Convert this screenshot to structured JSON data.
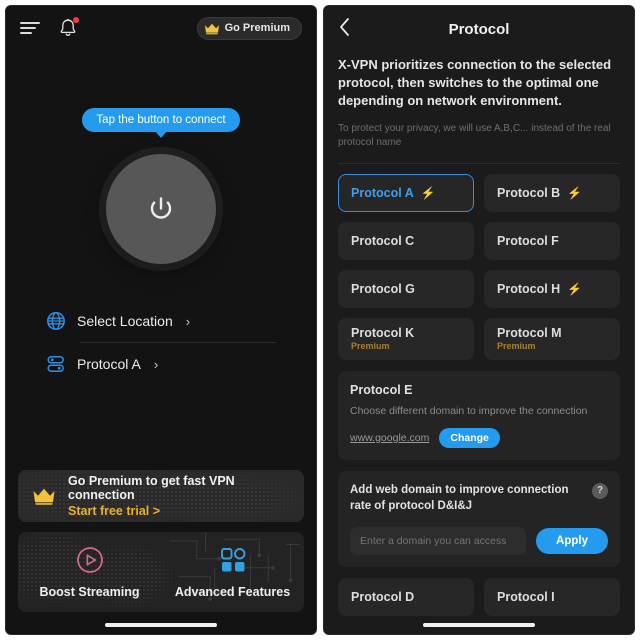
{
  "home": {
    "topbar": {
      "menu_icon": "hamburger-menu-icon",
      "notifications_icon": "bell-icon",
      "premium_button_label": "Go Premium",
      "premium_icon": "crown-icon"
    },
    "connect": {
      "tooltip": "Tap the button to connect",
      "power_icon": "power-icon"
    },
    "rows": [
      {
        "label": "Select Location",
        "chevron": "›",
        "icon": "globe-icon"
      },
      {
        "label": "Protocol A",
        "chevron": "›",
        "icon": "protocol-icon"
      }
    ],
    "banner": {
      "title": "Go Premium to get fast VPN connection",
      "cta": "Start free trial >",
      "icon": "crown-icon"
    },
    "features": [
      {
        "label": "Boost Streaming",
        "icon": "play-circle-icon",
        "color": "#d9658f"
      },
      {
        "label": "Advanced Features",
        "icon": "grid-squares-icon",
        "color": "#34a0e0"
      }
    ]
  },
  "protocol": {
    "header": {
      "back_icon": "chevron-left-icon",
      "title": "Protocol"
    },
    "description": "X-VPN prioritizes connection to the selected protocol, then switches to the optimal one depending on network environment.",
    "privacy_note": "To protect your privacy, we will use A,B,C... instead of the real protocol name",
    "items_top": [
      {
        "name": "Protocol A",
        "bolt": "⚡",
        "selected": true,
        "premium": ""
      },
      {
        "name": "Protocol B",
        "bolt": "⚡",
        "selected": false,
        "premium": ""
      },
      {
        "name": "Protocol C",
        "bolt": "",
        "selected": false,
        "premium": ""
      },
      {
        "name": "Protocol F",
        "bolt": "",
        "selected": false,
        "premium": ""
      },
      {
        "name": "Protocol G",
        "bolt": "",
        "selected": false,
        "premium": ""
      },
      {
        "name": "Protocol H",
        "bolt": "⚡",
        "selected": false,
        "premium": ""
      },
      {
        "name": "Protocol K",
        "bolt": "",
        "selected": false,
        "premium": "Premium"
      },
      {
        "name": "Protocol M",
        "bolt": "",
        "selected": false,
        "premium": "Premium"
      }
    ],
    "protocol_e_card": {
      "title": "Protocol E",
      "subtitle": "Choose different domain to improve the connection",
      "domain": "www.google.com",
      "change_label": "Change"
    },
    "add_domain_card": {
      "title": "Add web domain to improve connection rate of protocol D&I&J",
      "help_icon": "question-mark-icon",
      "input_placeholder": "Enter a domain you can access",
      "input_value": "",
      "apply_label": "Apply"
    },
    "items_bottom": [
      {
        "name": "Protocol D",
        "bolt": "",
        "selected": false,
        "premium": ""
      },
      {
        "name": "Protocol I",
        "bolt": "",
        "selected": false,
        "premium": ""
      }
    ]
  },
  "colors": {
    "accent_blue": "#259bf0",
    "gold": "#e9b225",
    "pink": "#d9658f",
    "alert_red": "#ff3b2f"
  }
}
